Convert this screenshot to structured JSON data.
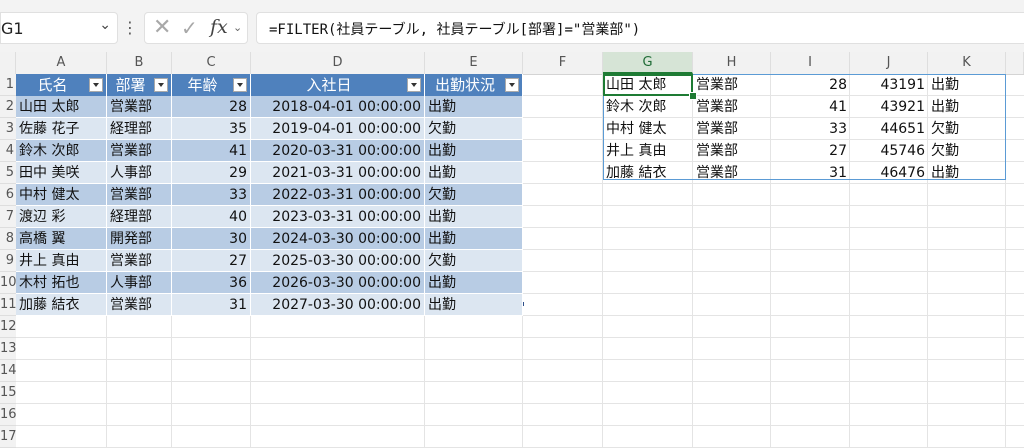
{
  "formula_bar": {
    "name_box": "G1",
    "cancel_icon": "x-icon",
    "enter_icon": "check-icon",
    "fx_label": "fx",
    "formula": "=FILTER(社員テーブル, 社員テーブル[部署]=\"営業部\")"
  },
  "columns": [
    "A",
    "B",
    "C",
    "D",
    "E",
    "F",
    "G",
    "H",
    "I",
    "J",
    "K"
  ],
  "rows": [
    "1",
    "2",
    "3",
    "4",
    "5",
    "6",
    "7",
    "8",
    "9",
    "10",
    "11",
    "12",
    "13",
    "14",
    "15",
    "16",
    "17"
  ],
  "table": {
    "headers": [
      "氏名",
      "部署",
      "年齢",
      "入社日",
      "出勤状況"
    ],
    "rows": [
      [
        "山田 太郎",
        "営業部",
        "28",
        "2018-04-01 00:00:00",
        "出勤"
      ],
      [
        "佐藤 花子",
        "経理部",
        "35",
        "2019-04-01 00:00:00",
        "欠勤"
      ],
      [
        "鈴木 次郎",
        "営業部",
        "41",
        "2020-03-31 00:00:00",
        "出勤"
      ],
      [
        "田中 美咲",
        "人事部",
        "29",
        "2021-03-31 00:00:00",
        "出勤"
      ],
      [
        "中村 健太",
        "営業部",
        "33",
        "2022-03-31 00:00:00",
        "欠勤"
      ],
      [
        "渡辺 彩",
        "経理部",
        "40",
        "2023-03-31 00:00:00",
        "出勤"
      ],
      [
        "高橋 翼",
        "開発部",
        "30",
        "2024-03-30 00:00:00",
        "出勤"
      ],
      [
        "井上 真由",
        "営業部",
        "27",
        "2025-03-30 00:00:00",
        "欠勤"
      ],
      [
        "木村 拓也",
        "人事部",
        "36",
        "2026-03-30 00:00:00",
        "出勤"
      ],
      [
        "加藤 結衣",
        "営業部",
        "31",
        "2027-03-30 00:00:00",
        "出勤"
      ]
    ]
  },
  "spill": {
    "rows": [
      [
        "山田 太郎",
        "営業部",
        "28",
        "43191",
        "出勤"
      ],
      [
        "鈴木 次郎",
        "営業部",
        "41",
        "43921",
        "出勤"
      ],
      [
        "中村 健太",
        "営業部",
        "33",
        "44651",
        "欠勤"
      ],
      [
        "井上 真由",
        "営業部",
        "27",
        "45746",
        "欠勤"
      ],
      [
        "加藤 結衣",
        "営業部",
        "31",
        "46476",
        "出勤"
      ]
    ]
  },
  "colors": {
    "header_blue": "#4f81bd",
    "band_dark": "#b8cce4",
    "band_light": "#dce6f1",
    "active_green": "#1e7b34"
  }
}
